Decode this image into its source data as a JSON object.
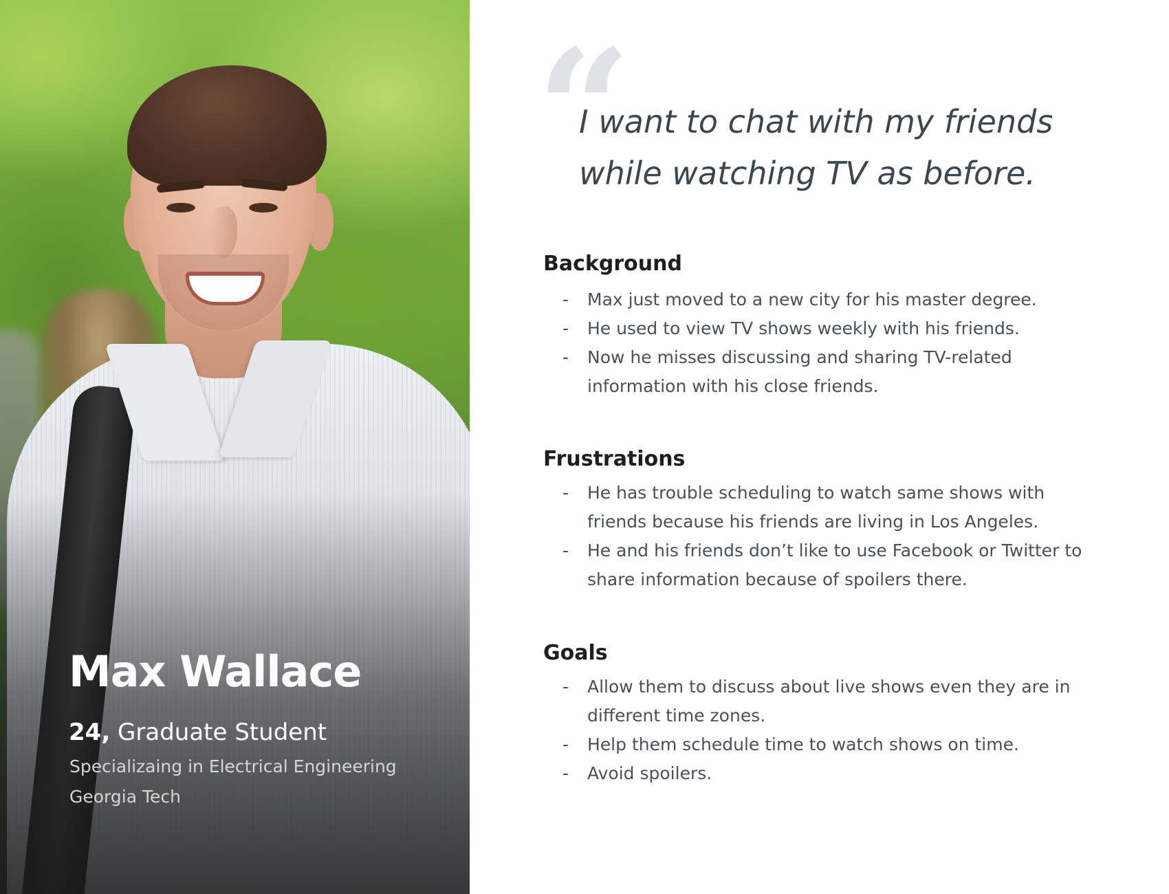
{
  "persona": {
    "name": "Max Wallace",
    "age": "24,",
    "occupation": "Graduate Student",
    "specialization": "Specializaing in Electrical Engineering",
    "school": "Georgia Tech"
  },
  "quote": {
    "line1": "I want to chat with my friends",
    "line2": "while watching TV as before."
  },
  "sections": {
    "background": {
      "title": "Background",
      "items": [
        "Max just moved to a new city for his master degree.",
        "He used to view TV shows weekly with his friends.",
        "Now he misses discussing and sharing TV-related information with his close friends."
      ]
    },
    "frustrations": {
      "title": "Frustrations",
      "items": [
        "He has trouble scheduling to watch same shows with friends because his friends are living in Los Angeles.",
        "He and his friends don’t like to use Facebook or Twitter to share information because of spoilers there."
      ]
    },
    "goals": {
      "title": "Goals",
      "items": [
        "Allow them to discuss about live shows even they are in different time zones.",
        "Help them schedule time to watch shows on time.",
        "Avoid spoilers."
      ]
    }
  },
  "bullet": "-",
  "colors": {
    "quote_text": "#3c4650",
    "quote_mark": "#dfe3e7",
    "heading": "#1e1e1e",
    "body_text": "#4a5058"
  }
}
